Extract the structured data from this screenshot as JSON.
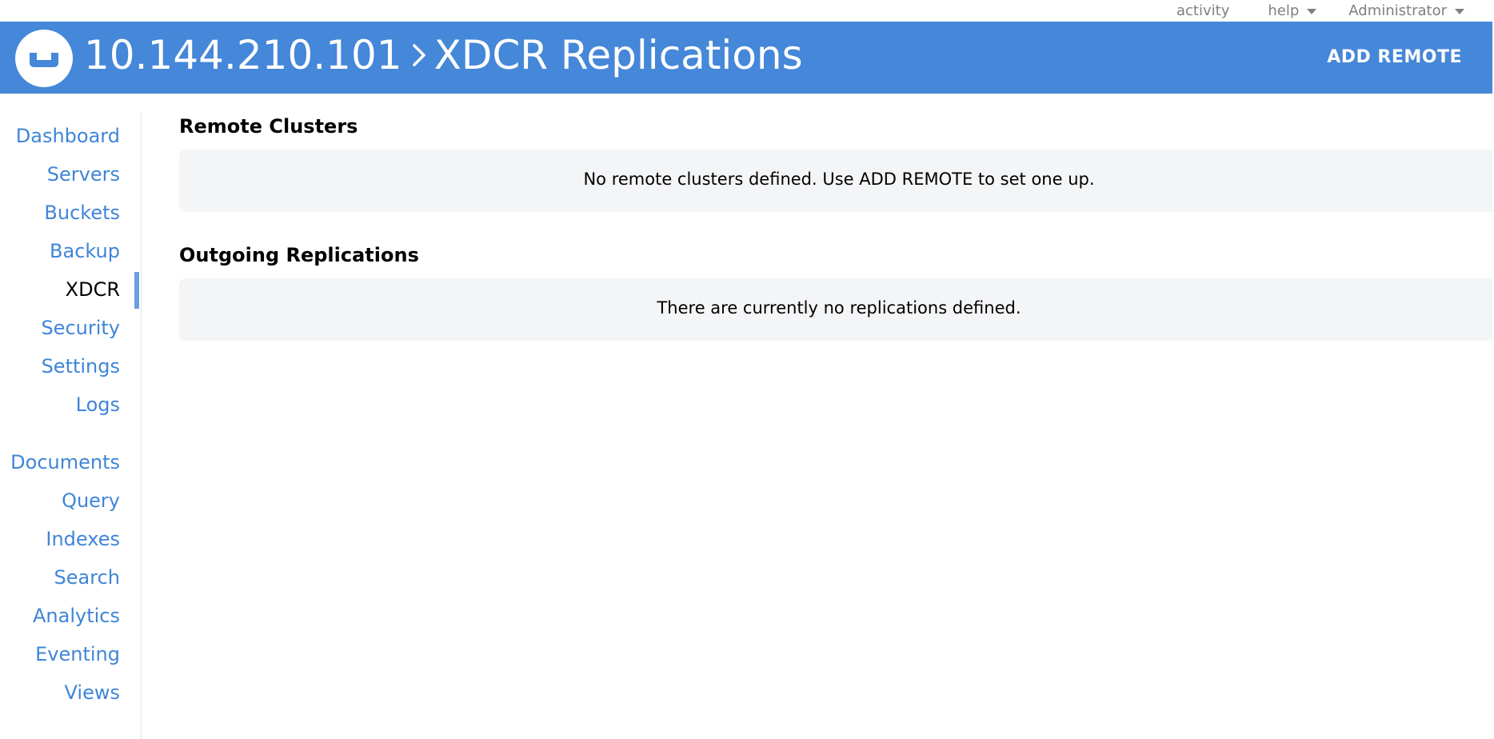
{
  "top_bar": {
    "activity": "activity",
    "help": "help",
    "user": "Administrator"
  },
  "header": {
    "host": "10.144.210.101",
    "page": "XDCR Replications",
    "add_remote": "ADD REMOTE"
  },
  "sidebar": {
    "items": [
      {
        "label": "Dashboard",
        "active": false
      },
      {
        "label": "Servers",
        "active": false
      },
      {
        "label": "Buckets",
        "active": false
      },
      {
        "label": "Backup",
        "active": false
      },
      {
        "label": "XDCR",
        "active": true
      },
      {
        "label": "Security",
        "active": false
      },
      {
        "label": "Settings",
        "active": false
      },
      {
        "label": "Logs",
        "active": false
      },
      {
        "label": "Documents",
        "active": false
      },
      {
        "label": "Query",
        "active": false
      },
      {
        "label": "Indexes",
        "active": false
      },
      {
        "label": "Search",
        "active": false
      },
      {
        "label": "Analytics",
        "active": false
      },
      {
        "label": "Eventing",
        "active": false
      },
      {
        "label": "Views",
        "active": false
      }
    ]
  },
  "main": {
    "remote_clusters": {
      "title": "Remote Clusters",
      "empty_message": "No remote clusters defined. Use ADD REMOTE to set one up."
    },
    "outgoing_replications": {
      "title": "Outgoing Replications",
      "empty_message": "There are currently no replications defined."
    }
  },
  "colors": {
    "header_bg": "#4587d8",
    "nav_link": "#3f85d8",
    "active_indicator": "#6c9ee3",
    "panel_bg": "#f4f5f7"
  },
  "icons": {
    "logo": "couchbase-logo-icon",
    "separator": "chevron-right-icon",
    "dropdown": "caret-down-icon"
  }
}
